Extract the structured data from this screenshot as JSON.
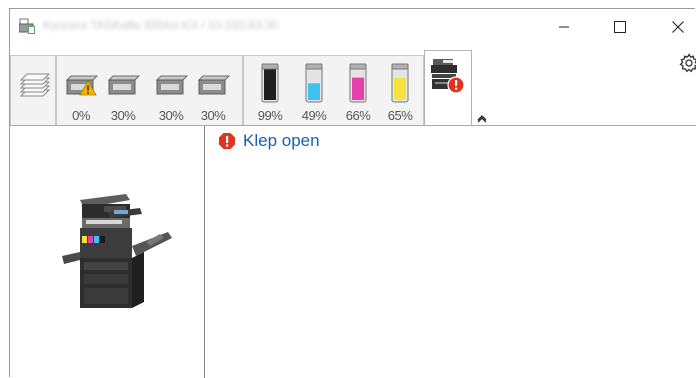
{
  "window": {
    "title": "Kyocera TASKalfa 3554ci KX / 10.150.63.30",
    "controls": [
      "minimize",
      "maximize",
      "close"
    ]
  },
  "toolbar": {
    "paper_trays": [
      {
        "label": "0%",
        "warning": true
      },
      {
        "label": "30%",
        "warning": false
      },
      {
        "label": "30%",
        "warning": false
      },
      {
        "label": "30%",
        "warning": false
      }
    ],
    "toners": [
      {
        "label": "99%",
        "color": "#1e1e1e",
        "level": 0.99
      },
      {
        "label": "49%",
        "color": "#3ec2f2",
        "level": 0.49
      },
      {
        "label": "66%",
        "color": "#e63fb0",
        "level": 0.66
      },
      {
        "label": "65%",
        "color": "#f7e23b",
        "level": 0.65
      }
    ],
    "status_tab_icon": "printer-error-icon",
    "settings_icon": "gear-icon",
    "collapse_icon": "chevron-up-icon"
  },
  "status": {
    "message": "Klep open",
    "icon": "error-icon",
    "color": "#1a5fb4"
  },
  "colors": {
    "error": "#e0341e",
    "warning": "#f0b400"
  }
}
